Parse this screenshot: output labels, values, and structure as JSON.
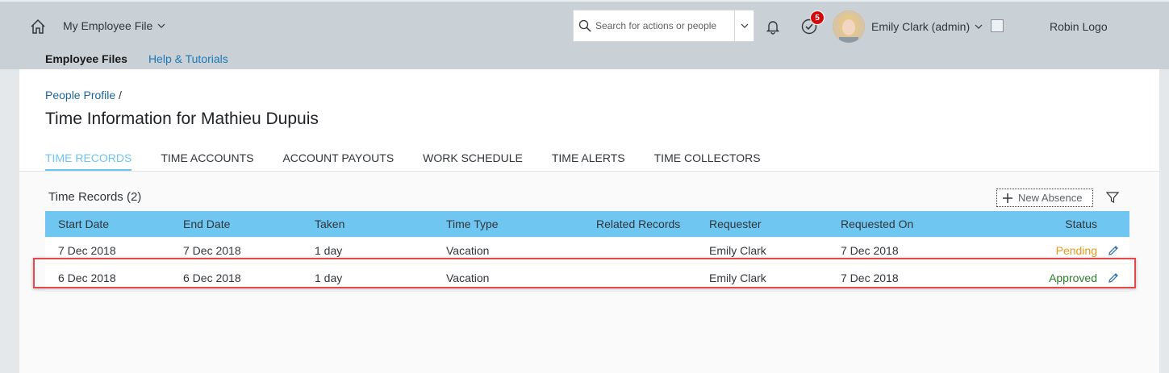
{
  "shell": {
    "app_title": "My Employee File",
    "search_placeholder": "Search for actions or people",
    "notification_count": "5",
    "user_name": "Emily Clark (admin)",
    "logo_text": "Robin Logo"
  },
  "subnav": {
    "item1": "Employee Files",
    "item2": "Help & Tutorials"
  },
  "header": {
    "breadcrumb_link": "People Profile",
    "breadcrumb_sep": " /",
    "title": "Time Information for Mathieu Dupuis"
  },
  "tabs": [
    "TIME RECORDS",
    "TIME ACCOUNTS",
    "ACCOUNT PAYOUTS",
    "WORK SCHEDULE",
    "TIME ALERTS",
    "TIME COLLECTORS"
  ],
  "section": {
    "title": "Time Records (2)",
    "new_button": "New Absence"
  },
  "table": {
    "columns": [
      "Start Date",
      "End Date",
      "Taken",
      "Time Type",
      "Related Records",
      "Requester",
      "Requested On",
      "Status"
    ],
    "rows": [
      {
        "start": "7 Dec 2018",
        "end": "7 Dec 2018",
        "taken": "1 day",
        "type": "Vacation",
        "related": "",
        "requester": "Emily Clark",
        "requested_on": "7 Dec 2018",
        "status": "Pending"
      },
      {
        "start": "6 Dec 2018",
        "end": "6 Dec 2018",
        "taken": "1 day",
        "type": "Vacation",
        "related": "",
        "requester": "Emily Clark",
        "requested_on": "7 Dec 2018",
        "status": "Approved"
      }
    ]
  },
  "colors": {
    "accent": "#6ec6f1",
    "pending": "#e69a1b",
    "approved": "#2b7d2b",
    "highlight": "#e4474d"
  }
}
